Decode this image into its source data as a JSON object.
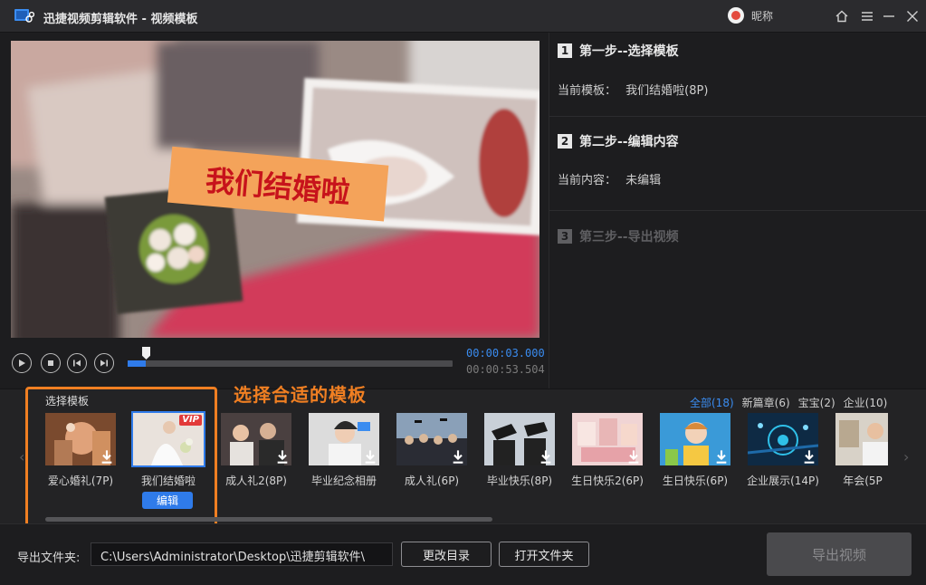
{
  "app": {
    "title": "迅捷视频剪辑软件 - 视频模板",
    "nickname": "昵称"
  },
  "preview": {
    "overlay_text": "我们结婚啦"
  },
  "player": {
    "current_time": "00:00:03.000",
    "total_time": "00:00:53.504",
    "progress_percent": 5.6
  },
  "steps": [
    {
      "num": "1",
      "label": "第一步--选择模板",
      "info_label": "当前模板：",
      "info_value": "我们结婚啦(8P)"
    },
    {
      "num": "2",
      "label": "第二步--编辑内容",
      "info_label": "当前内容：",
      "info_value": "未编辑"
    },
    {
      "num": "3",
      "label": "第三步--导出视频"
    }
  ],
  "templates": {
    "section_label": "选择模板",
    "annotation": "选择合适的模板",
    "categories": [
      {
        "label": "全部(18)",
        "active": true
      },
      {
        "label": "新篇章(6)",
        "active": false
      },
      {
        "label": "宝宝(2)",
        "active": false
      },
      {
        "label": "企业(10)",
        "active": false
      }
    ],
    "items": [
      {
        "name": "爱心婚礼(7P)",
        "icon": "download-icon"
      },
      {
        "name": "我们结婚啦",
        "icon": "vip-badge",
        "vip": "VIP",
        "selected": true,
        "action": "编辑"
      },
      {
        "name": "成人礼2(8P)",
        "icon": "download-icon"
      },
      {
        "name": "毕业纪念相册",
        "icon": "download-icon"
      },
      {
        "name": "成人礼(6P)",
        "icon": "download-icon"
      },
      {
        "name": "毕业快乐(8P)",
        "icon": "download-icon"
      },
      {
        "name": "生日快乐2(6P)",
        "icon": "download-icon"
      },
      {
        "name": "生日快乐(6P)",
        "icon": "download-icon"
      },
      {
        "name": "企业展示(14P)",
        "icon": "download-icon"
      },
      {
        "name": "年会(5P",
        "icon": "download-icon"
      }
    ]
  },
  "export": {
    "folder_label": "导出文件夹:",
    "folder_path": "C:\\Users\\Administrator\\Desktop\\迅捷剪辑软件\\",
    "change_dir": "更改目录",
    "open_folder": "打开文件夹",
    "export_video": "导出视频"
  },
  "colors": {
    "accent": "#2f7bea",
    "annotation": "#f07f22",
    "vip": "#e23a3a"
  }
}
